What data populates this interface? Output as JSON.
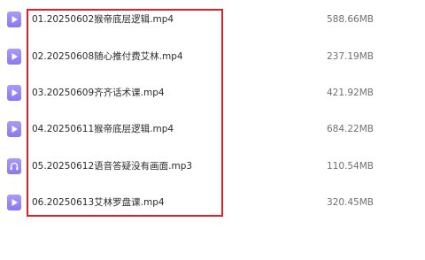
{
  "files": [
    {
      "name": "01.20250602猴帝底层逻辑.mp4",
      "size": "588.66MB",
      "type": "video",
      "icon": "video-file-icon"
    },
    {
      "name": "02.20250608随心推付费艾林.mp4",
      "size": "237.19MB",
      "type": "video",
      "icon": "video-file-icon"
    },
    {
      "name": "03.20250609齐齐话术课.mp4",
      "size": "421.92MB",
      "type": "video",
      "icon": "video-file-icon"
    },
    {
      "name": "04.20250611猴帝底层逻辑.mp4",
      "size": "684.22MB",
      "type": "video",
      "icon": "video-file-icon"
    },
    {
      "name": "05.20250612语音答疑没有画面.mp3",
      "size": "110.54MB",
      "type": "audio",
      "icon": "audio-file-icon"
    },
    {
      "name": "06.20250613艾林罗盘课.mp4",
      "size": "320.45MB",
      "type": "video",
      "icon": "video-file-icon"
    }
  ],
  "colors": {
    "icon_purple": "#8a78ee",
    "highlight_red": "#d8232a"
  }
}
